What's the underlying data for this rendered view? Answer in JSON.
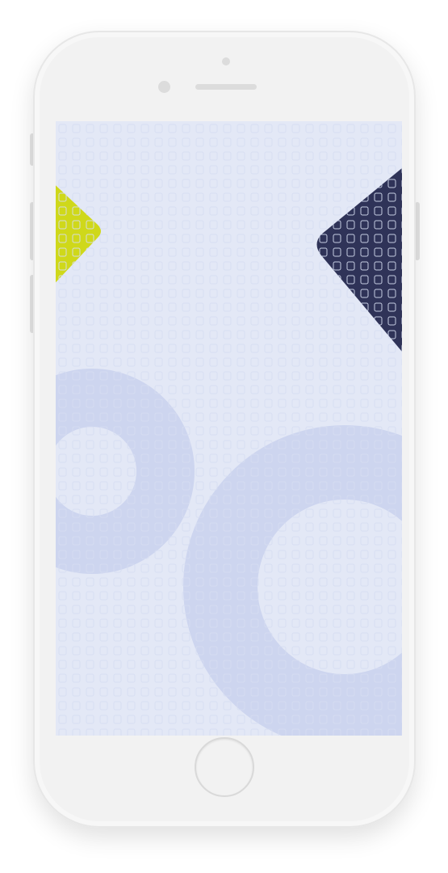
{
  "device": {
    "type": "smartphone-mockup",
    "color": "#f2f2f2"
  },
  "screen": {
    "background_color": "#e3e8f6",
    "pattern": "grid-of-small-squares",
    "shapes": [
      {
        "kind": "diamond",
        "color": "#cfd81a"
      },
      {
        "kind": "diamond",
        "color": "#2f3358"
      },
      {
        "kind": "ring",
        "color": "#cdd5ef"
      },
      {
        "kind": "ring",
        "color": "#cdd5ef"
      }
    ]
  },
  "icons": {
    "home_button": "home-button-icon",
    "camera": "camera-icon",
    "speaker": "speaker-icon"
  }
}
